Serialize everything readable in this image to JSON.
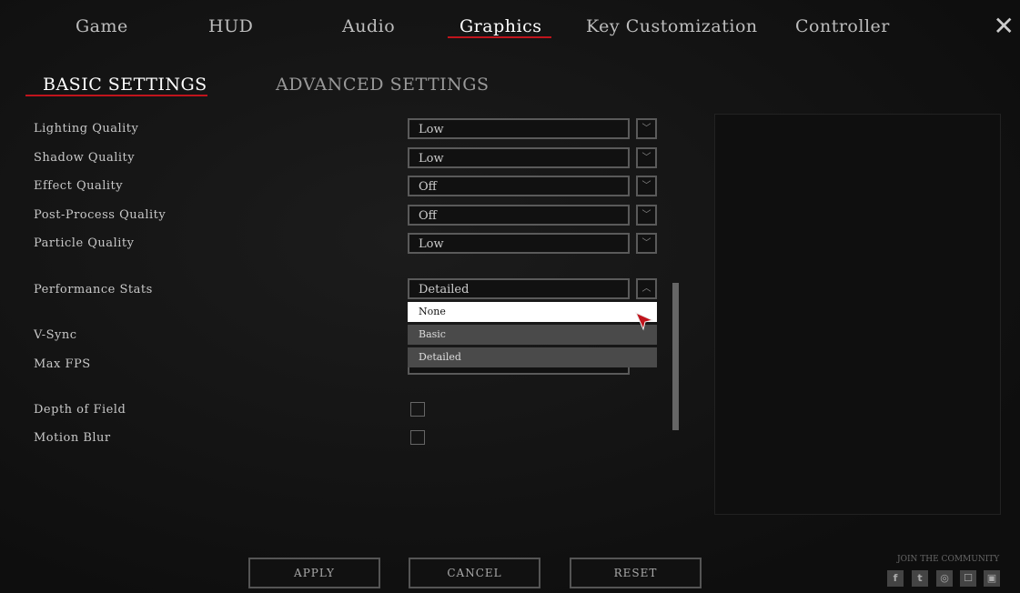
{
  "tabs": [
    "Game",
    "HUD",
    "Audio",
    "Graphics",
    "Key Customization",
    "Controller"
  ],
  "subtabs": [
    "BASIC SETTINGS",
    "ADVANCED SETTINGS"
  ],
  "settings": [
    {
      "label": "Lighting Quality",
      "value": "Low"
    },
    {
      "label": "Shadow Quality",
      "value": "Low"
    },
    {
      "label": "Effect Quality",
      "value": "Off"
    },
    {
      "label": "Post-Process Quality",
      "value": "Off"
    },
    {
      "label": "Particle Quality",
      "value": "Low"
    },
    {
      "label": "Performance Stats",
      "value": "Detailed"
    }
  ],
  "dropdown_options": [
    "None",
    "Basic",
    "Detailed"
  ],
  "labels2": [
    "V-Sync",
    "Max FPS",
    "Depth of Field",
    "Motion Blur"
  ],
  "buttons": [
    "APPLY",
    "CANCEL",
    "RESET"
  ],
  "community": "JOIN THE COMMUNITY",
  "social": [
    "facebook-icon",
    "twitter-icon",
    "instagram-icon",
    "discord-icon",
    "twitch-icon"
  ],
  "accent": "#c0141c"
}
